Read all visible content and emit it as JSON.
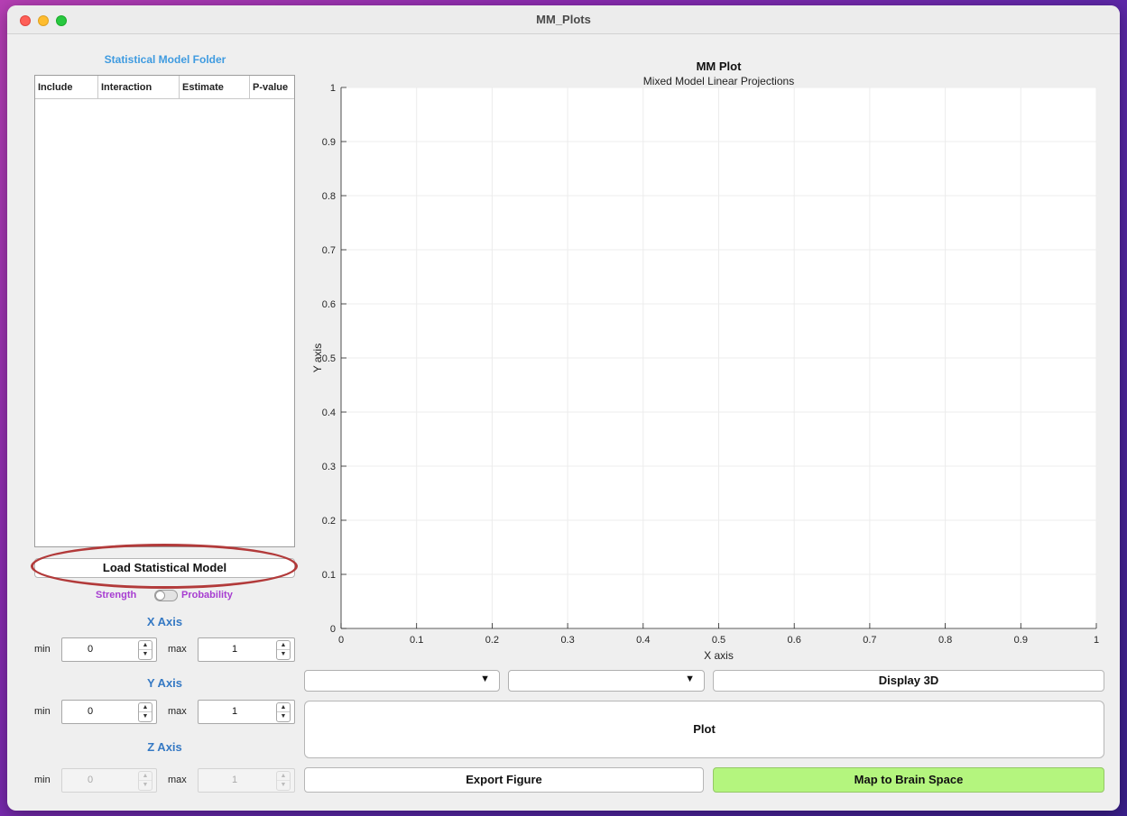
{
  "window": {
    "title": "MM_Plots"
  },
  "model_panel": {
    "folder_label": "Statistical Model Folder",
    "columns": [
      "Include",
      "Interaction",
      "Estimate",
      "P-value"
    ],
    "load_button": "Load Statistical Model",
    "switch": {
      "left_label": "Strength",
      "right_label": "Probability",
      "state": "Strength"
    }
  },
  "axes_limits": {
    "x": {
      "title": "X Axis",
      "min_label": "min",
      "max_label": "max",
      "min": "0",
      "max": "1",
      "enabled": true
    },
    "y": {
      "title": "Y Axis",
      "min_label": "min",
      "max_label": "max",
      "min": "0",
      "max": "1",
      "enabled": true
    },
    "z": {
      "title": "Z Axis",
      "min_label": "min",
      "max_label": "max",
      "min": "0",
      "max": "1",
      "enabled": false
    }
  },
  "plot_controls": {
    "dropdown1": {
      "value": ""
    },
    "dropdown2": {
      "value": ""
    },
    "display3d": "Display 3D",
    "plot": "Plot",
    "export": "Export Figure",
    "map": "Map to Brain Space",
    "map_color": "#b4f57e"
  },
  "chart_data": {
    "type": "line",
    "title": "MM Plot",
    "subtitle": "Mixed Model Linear Projections",
    "xlabel": "X axis",
    "ylabel": "Y axis",
    "xlim": [
      0,
      1
    ],
    "ylim": [
      0,
      1
    ],
    "xticks": [
      "0",
      "0.1",
      "0.2",
      "0.3",
      "0.4",
      "0.5",
      "0.6",
      "0.7",
      "0.8",
      "0.9",
      "1"
    ],
    "yticks": [
      "0",
      "0.1",
      "0.2",
      "0.3",
      "0.4",
      "0.5",
      "0.6",
      "0.7",
      "0.8",
      "0.9",
      "1"
    ],
    "grid": true,
    "series": []
  }
}
